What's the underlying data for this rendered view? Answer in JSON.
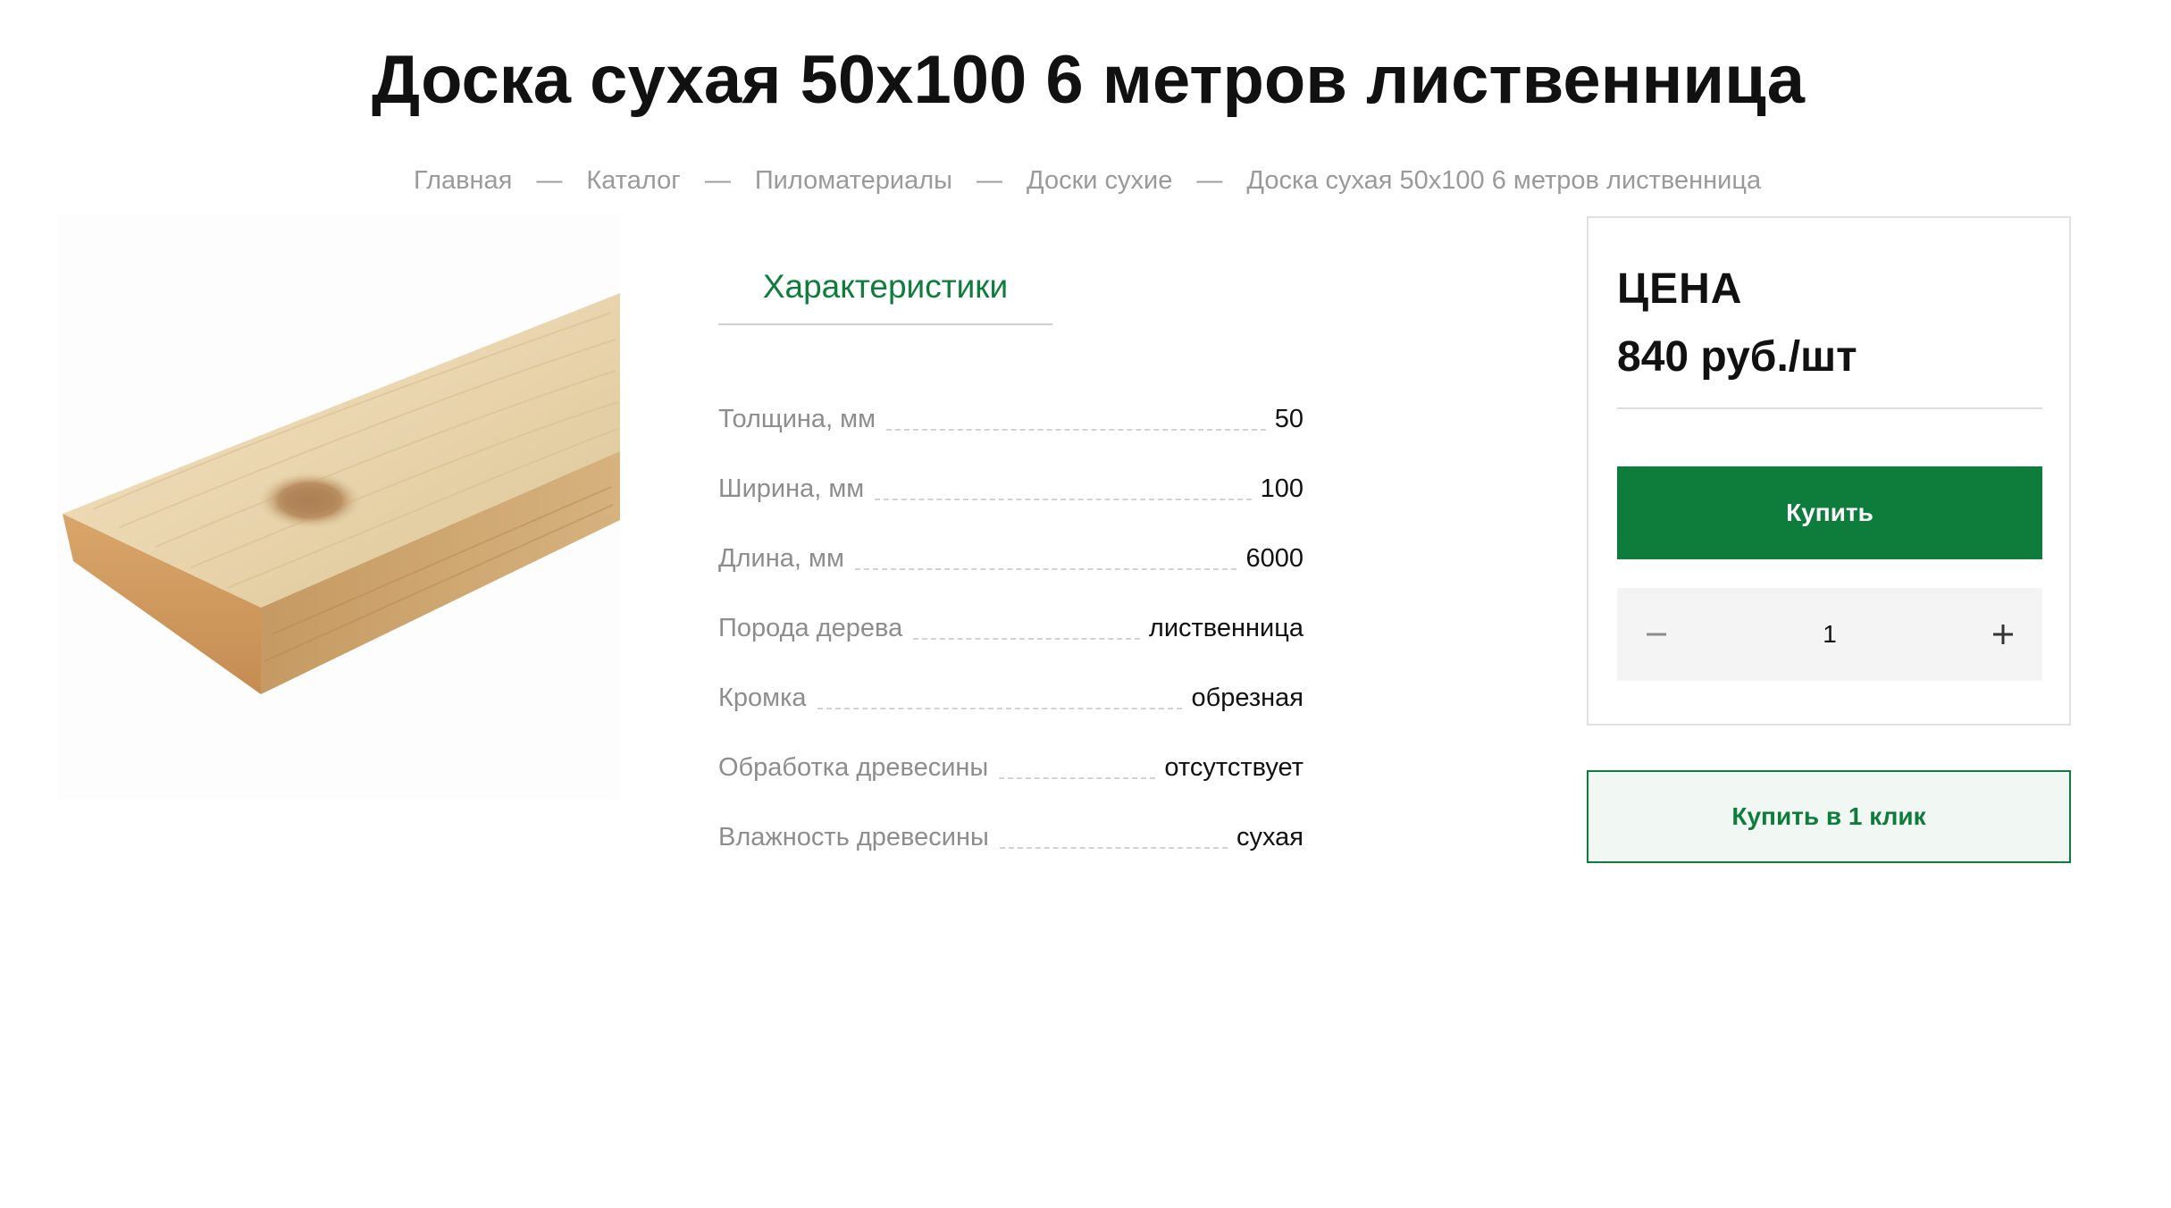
{
  "product": {
    "title": "Доска сухая 50х100 6 метров лиственница",
    "image_alt": "Доска сухая 50х100 6 метров лиственница"
  },
  "breadcrumb": [
    {
      "label": "Главная"
    },
    {
      "label": "Каталог"
    },
    {
      "label": "Пиломатериалы"
    },
    {
      "label": "Доски сухие"
    },
    {
      "label": "Доска сухая 50х100 6 метров лиственница"
    }
  ],
  "breadcrumb_separator": "—",
  "specs": {
    "tab_label": "Характеристики",
    "rows": [
      {
        "label": "Толщина, мм",
        "value": "50"
      },
      {
        "label": "Ширина, мм",
        "value": "100"
      },
      {
        "label": "Длина, мм",
        "value": "6000"
      },
      {
        "label": "Порода дерева",
        "value": "лиственница"
      },
      {
        "label": "Кромка",
        "value": "обрезная"
      },
      {
        "label": "Обработка древесины",
        "value": "отсутствует"
      },
      {
        "label": "Влажность древесины",
        "value": "сухая"
      }
    ]
  },
  "price_card": {
    "label": "ЦЕНА",
    "price": "840 руб./шт",
    "buy_label": "Купить",
    "quantity": "1",
    "minus_icon": "minus-icon",
    "plus_icon": "plus-icon"
  },
  "one_click": {
    "label": "Купить в 1 клик"
  },
  "colors": {
    "accent": "#0e7d3c",
    "accent_light": "#f1f8f3",
    "muted_text": "#9a9a9a"
  }
}
